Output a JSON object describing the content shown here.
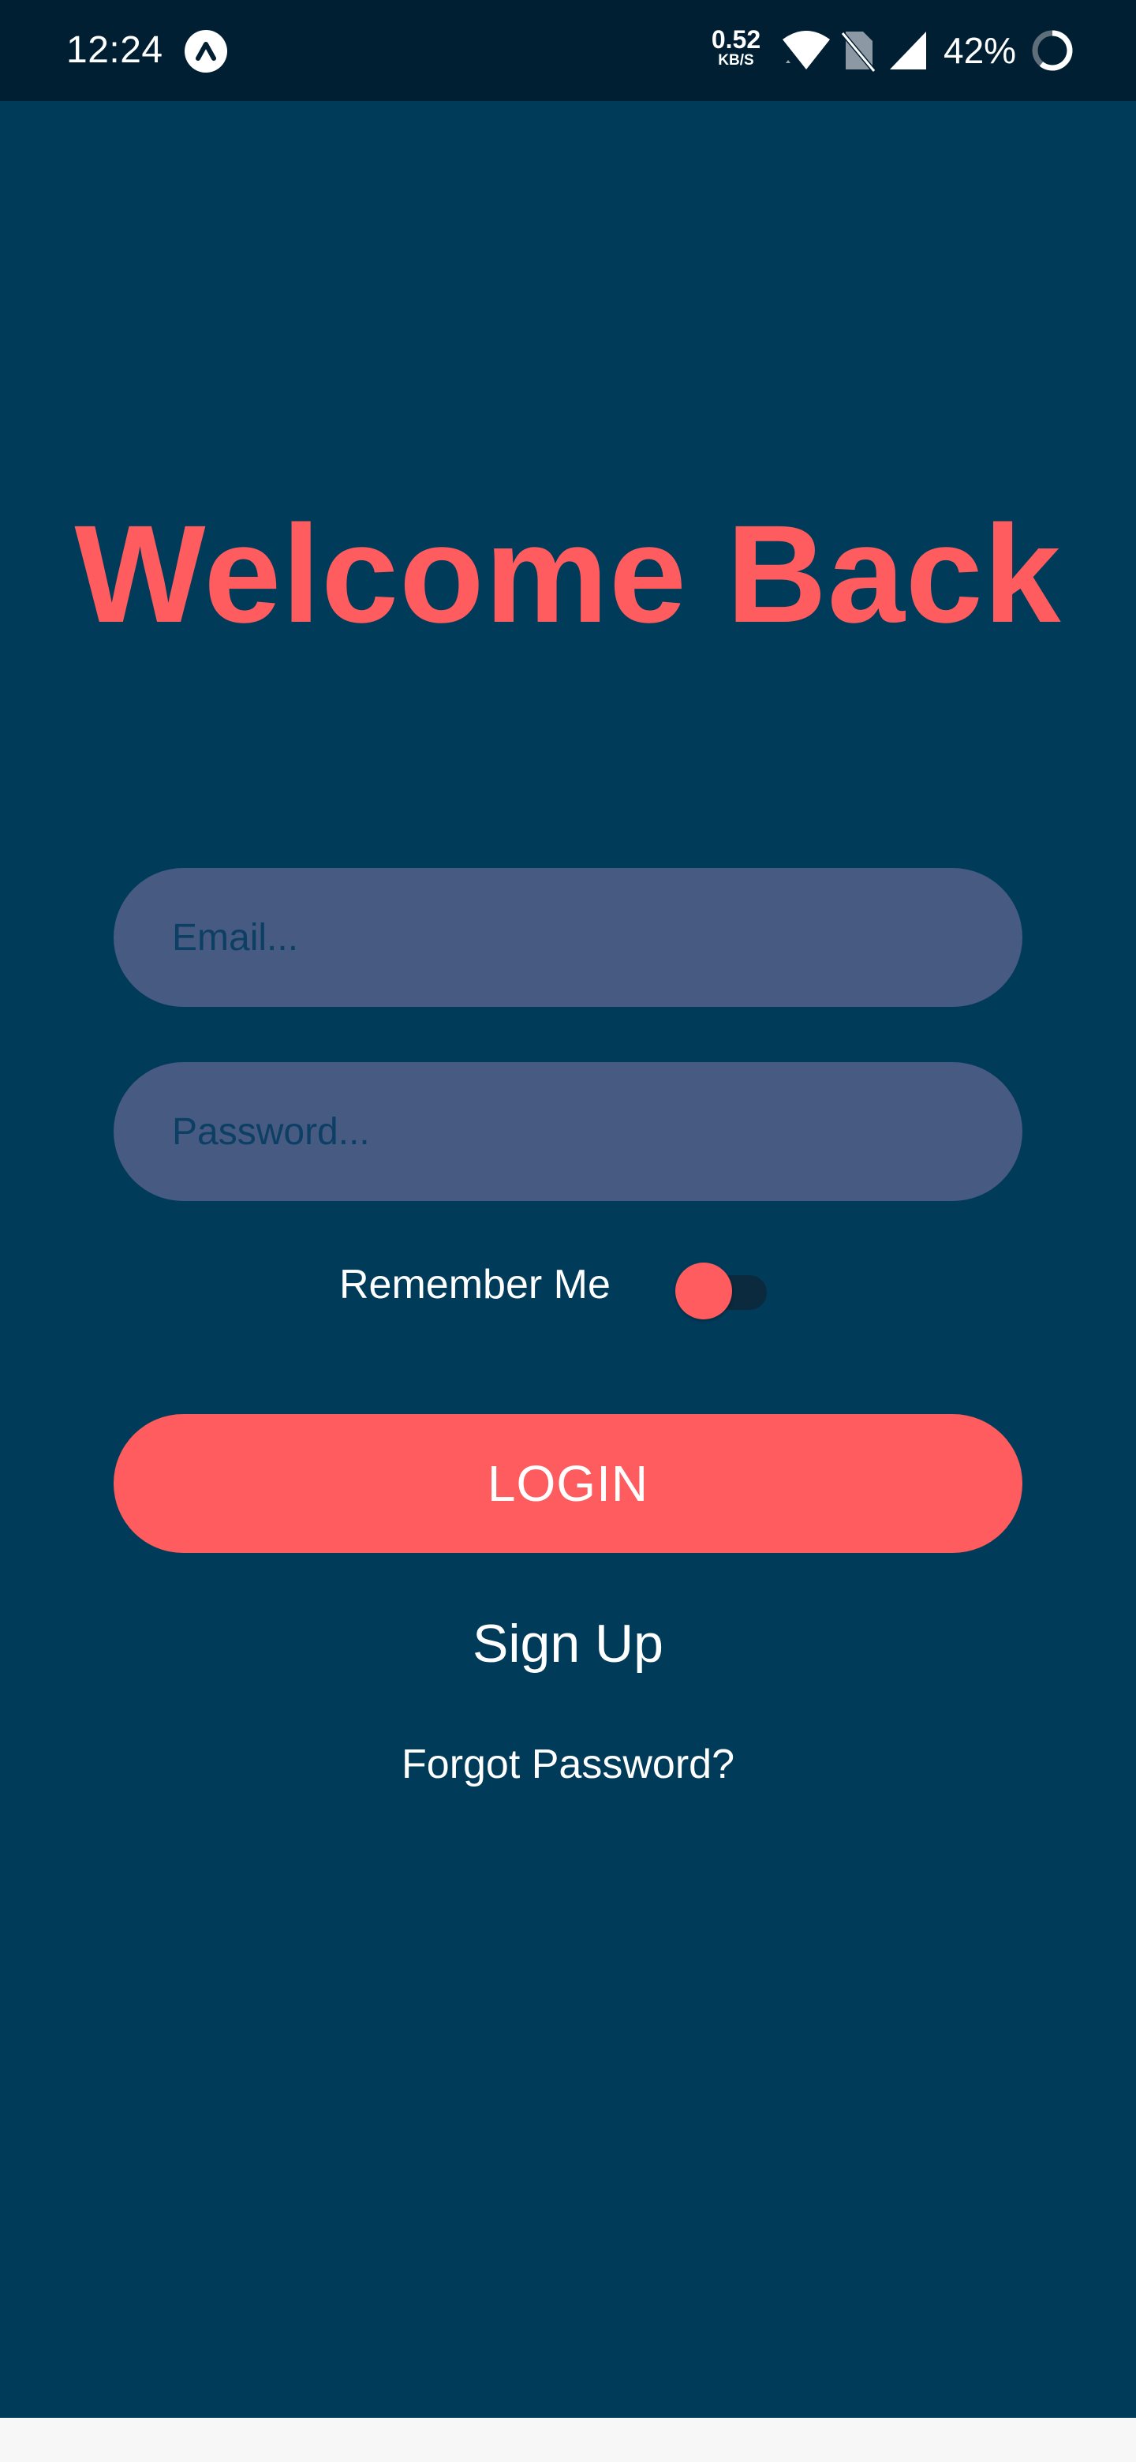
{
  "status_bar": {
    "time": "12:24",
    "net_speed_value": "0.52",
    "net_speed_unit": "KB/S",
    "battery_percent": "42%",
    "icons": [
      "app-notification-icon",
      "wifi-icon",
      "no-sim-icon",
      "cell-signal-icon",
      "battery-ring-icon"
    ]
  },
  "login": {
    "title": "Welcome Back",
    "email_placeholder": "Email...",
    "password_placeholder": "Password...",
    "remember_label": "Remember Me",
    "remember_toggle_on": true,
    "login_label": "LOGIN",
    "signup_label": "Sign Up",
    "forgot_label": "Forgot Password?"
  },
  "colors": {
    "background": "#003b5a",
    "status_bar": "#001f33",
    "accent": "#fe5c5e",
    "input_fill": "#465a82",
    "placeholder": "#0c3f63",
    "text": "#ffffff"
  }
}
